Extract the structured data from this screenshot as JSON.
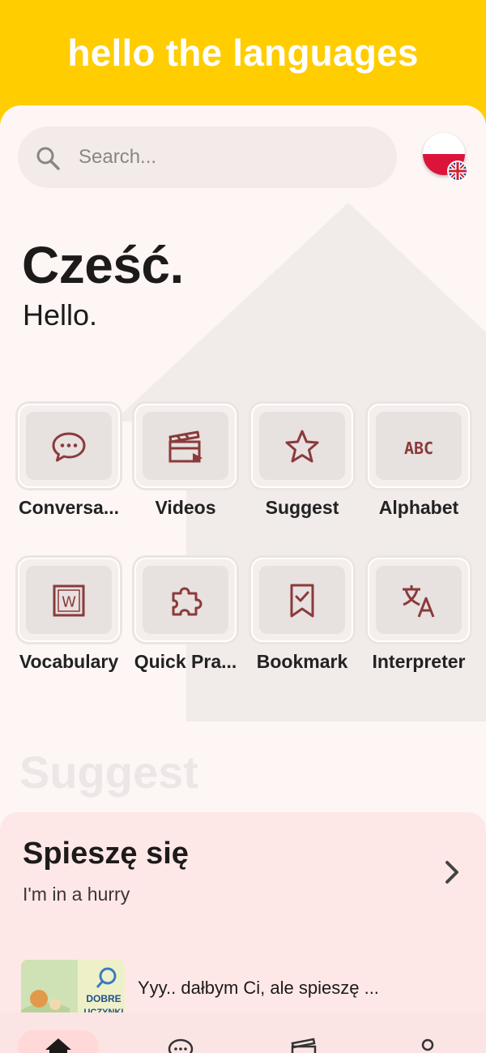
{
  "app": {
    "title": "hello the languages"
  },
  "search": {
    "placeholder": "Search..."
  },
  "language": {
    "flag": "poland-flag-icon",
    "badge": "uk-flag-icon"
  },
  "greeting": {
    "native": "Cześć.",
    "translation": "Hello."
  },
  "categories": [
    {
      "label": "Conversa...",
      "icon": "chat-bubble-icon"
    },
    {
      "label": "Videos",
      "icon": "clapperboard-icon"
    },
    {
      "label": "Suggest",
      "icon": "star-icon"
    },
    {
      "label": "Alphabet",
      "icon": "abc-icon"
    },
    {
      "label": "Vocabulary",
      "icon": "word-doc-icon"
    },
    {
      "label": "Quick Pra...",
      "icon": "puzzle-icon"
    },
    {
      "label": "Bookmark",
      "icon": "bookmark-check-icon"
    },
    {
      "label": "Interpreter",
      "icon": "translate-icon"
    }
  ],
  "suggest_section": {
    "heading": "Suggest",
    "card": {
      "title": "Spieszę się",
      "subtitle": "I'm in a hurry",
      "thumbnail_text": [
        "DOBRE",
        "UCZYNKI"
      ],
      "snippet": "Yyy.. dałbym Ci, ale spieszę ..."
    }
  },
  "bottom_nav": [
    "home-icon",
    "chat-bubble-icon",
    "clapperboard-icon",
    "profile-icon"
  ],
  "colors": {
    "accent": "#ffcd00",
    "icon": "#8b3a3a",
    "sheet": "#fdf6f5",
    "card": "#fde8e7"
  }
}
